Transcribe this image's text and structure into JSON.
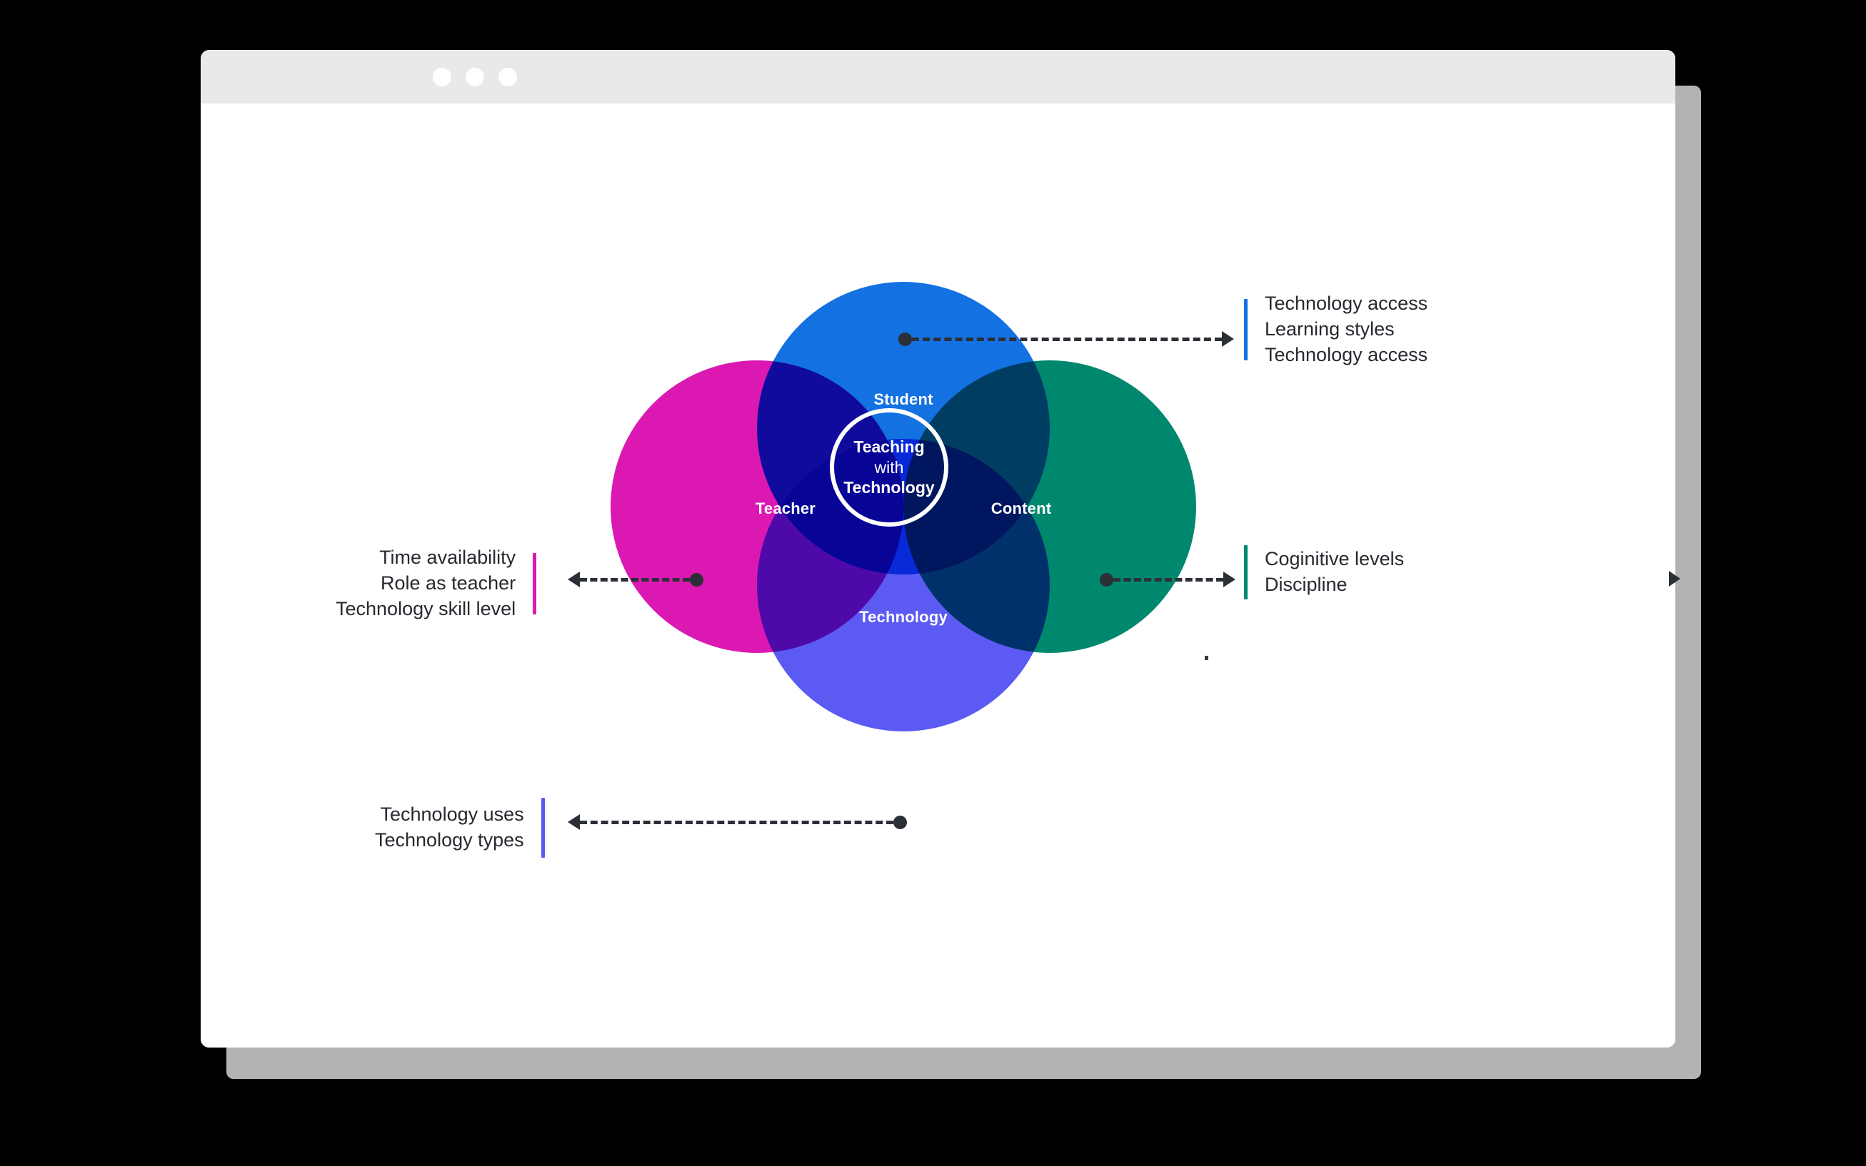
{
  "window": {
    "traffic_lights": [
      "close-dot",
      "minimize-dot",
      "maximize-dot"
    ]
  },
  "diagram": {
    "title": "Teaching with Technology Venn Diagram",
    "center": {
      "line1": "Teaching",
      "line2": "with",
      "line3": "Technology"
    },
    "circles": [
      {
        "id": "student",
        "label": "Student",
        "color": "#1371e2",
        "position": "top"
      },
      {
        "id": "teacher",
        "label": "Teacher",
        "color": "#db18b1",
        "position": "left"
      },
      {
        "id": "content",
        "label": "Content",
        "color": "#00886f",
        "position": "right"
      },
      {
        "id": "technology",
        "label": "Technology",
        "color": "#5b5bf4",
        "position": "bottom"
      }
    ],
    "callouts": [
      {
        "id": "student-callout",
        "side": "right",
        "accent": "#1371e2",
        "lines": [
          "Technology access",
          "Learning styles",
          "Technology access"
        ],
        "text": "Technology access\nLearning styles\nTechnology access"
      },
      {
        "id": "content-callout",
        "side": "right",
        "accent": "#00886f",
        "lines": [
          "Coginitive levels",
          "Discipline"
        ],
        "text": "Coginitive levels\nDiscipline"
      },
      {
        "id": "teacher-callout",
        "side": "left",
        "accent": "#db18b1",
        "lines": [
          "Time availability",
          "Role as teacher",
          "Technology skill level"
        ],
        "text": "Time availability\nRole as teacher\nTechnology skill level"
      },
      {
        "id": "technology-callout",
        "side": "left",
        "accent": "#5b5bf4",
        "lines": [
          "Technology uses",
          "Technology types"
        ],
        "text": "Technology uses\nTechnology types"
      }
    ]
  }
}
